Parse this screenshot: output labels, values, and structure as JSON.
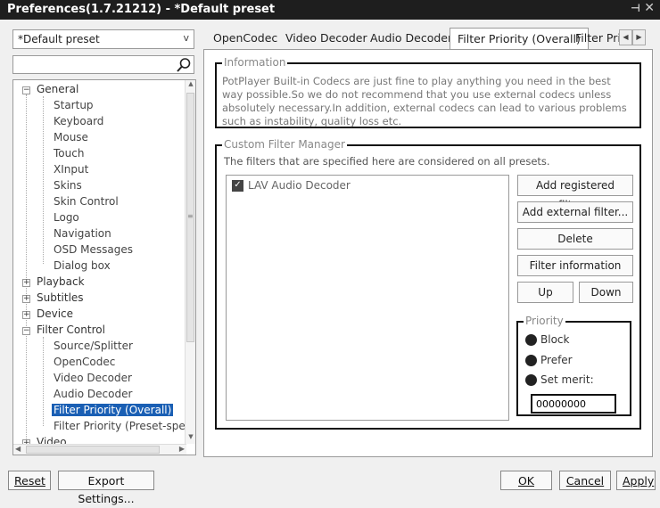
{
  "window": {
    "title": "Preferences(1.7.21212) - *Default preset"
  },
  "preset": {
    "selected": "*Default preset"
  },
  "search": {
    "placeholder": ""
  },
  "tree": {
    "general": "General",
    "general_children": [
      "Startup",
      "Keyboard",
      "Mouse",
      "Touch",
      "XInput",
      "Skins",
      "Skin Control",
      "Logo",
      "Navigation",
      "OSD Messages",
      "Dialog box"
    ],
    "playback": "Playback",
    "subtitles": "Subtitles",
    "device": "Device",
    "filter_control": "Filter Control",
    "filter_children": [
      "Source/Splitter",
      "OpenCodec",
      "Video Decoder",
      "Audio Decoder",
      "Filter Priority (Overall)",
      "Filter Priority (Preset-specific)"
    ],
    "video": "Video"
  },
  "tabs": [
    "OpenCodec",
    "Video Decoder",
    "Audio Decoder",
    "Filter Priority (Overall)",
    "Filter Prio"
  ],
  "information": {
    "label": "Information",
    "text": "PotPlayer Built-in Codecs are just fine to play anything you need in the best way possible.So we do not recommend that you use external codecs unless absolutely necessary.In addition, external codecs can lead to various problems such as instability, quality loss etc."
  },
  "filter_manager": {
    "label": "Custom Filter Manager",
    "description": "The filters that are specified here are considered on all presets.",
    "filters": [
      {
        "name": "LAV Audio Decoder",
        "checked": true
      }
    ],
    "buttons": {
      "add_registered": "Add registered filter...",
      "add_external": "Add external filter...",
      "delete": "Delete",
      "filter_info": "Filter information",
      "up": "Up",
      "down": "Down"
    }
  },
  "priority": {
    "label": "Priority",
    "options": [
      "Block",
      "Prefer",
      "Set merit:"
    ],
    "merit_value": "00000000"
  },
  "bottom": {
    "reset": "Reset",
    "export": "Export Settings...",
    "ok": "OK",
    "cancel": "Cancel",
    "apply": "Apply"
  }
}
